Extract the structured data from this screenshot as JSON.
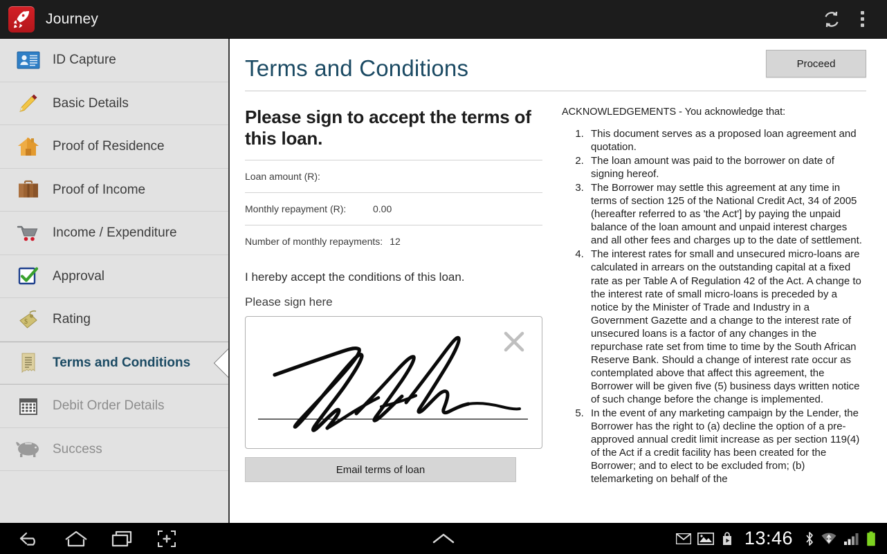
{
  "actionbar": {
    "app_name": "Journey",
    "logo_icon": "rocket-icon",
    "refresh_icon": "refresh-icon",
    "overflow_icon": "overflow-menu-icon"
  },
  "sidebar": {
    "items": [
      {
        "label": "ID Capture",
        "icon": "id-card-icon",
        "state": "normal"
      },
      {
        "label": "Basic Details",
        "icon": "pencil-icon",
        "state": "normal"
      },
      {
        "label": "Proof of Residence",
        "icon": "house-icon",
        "state": "normal"
      },
      {
        "label": "Proof of Income",
        "icon": "briefcase-icon",
        "state": "normal"
      },
      {
        "label": "Income / Expenditure",
        "icon": "cart-icon",
        "state": "normal"
      },
      {
        "label": "Approval",
        "icon": "checkbox-icon",
        "state": "normal"
      },
      {
        "label": "Rating",
        "icon": "tag-icon",
        "state": "normal"
      },
      {
        "label": "Terms and Conditions",
        "icon": "receipt-icon",
        "state": "active"
      },
      {
        "label": "Debit Order Details",
        "icon": "calendar-icon",
        "state": "muted"
      },
      {
        "label": "Success",
        "icon": "piggy-bank-icon",
        "state": "muted"
      }
    ]
  },
  "main": {
    "page_title": "Terms and Conditions",
    "proceed_label": "Proceed",
    "sign_heading": "Please sign to accept the terms of this loan.",
    "fields": [
      {
        "key": "Loan amount (R):",
        "value": ""
      },
      {
        "key": "Monthly repayment (R):",
        "value": "0.00"
      },
      {
        "key": "Number of monthly repayments:",
        "value": "12"
      }
    ],
    "accept_line": "I hereby accept the conditions of this loan.",
    "sign_prompt": "Please sign here",
    "clear_signature_icon": "clear-x-icon",
    "email_label": "Email terms of loan",
    "ack_title": "ACKNOWLEDGEMENTS - You acknowledge that:",
    "ack_items": [
      "This document serves as a proposed loan agreement and quotation.",
      "The loan amount was paid to the borrower on date of signing hereof.",
      "The Borrower may settle this agreement at any time in terms of section 125 of the National Credit Act, 34 of 2005 (hereafter referred to as 'the Act'] by paying the unpaid balance of the loan amount and unpaid interest charges and all other fees and charges up to the date of settlement.",
      "The interest rates for small and unsecured micro-loans are calculated in arrears on the outstanding capital at a fixed rate as per Table A of Regulation 42 of the Act. A change to the interest rate of small micro-loans is preceded by a notice by the Minister of Trade and Industry in a Government Gazette and a change to the interest rate of unsecured loans is a factor of any changes in the repurchase rate set from time to time by the South African Reserve Bank. Should a change of interest rate occur as contemplated above that affect this agreement, the Borrower will be given five (5) business days written notice of such change before the change is implemented.",
      "In the event of any marketing campaign by the Lender, the Borrower has the right to (a) decline the option of a pre-approved annual credit limit increase as per section 119(4) of the Act if a credit facility has been created for the Borrower; and to elect to be excluded from; (b) telemarketing on behalf of the"
    ]
  },
  "systembar": {
    "back_icon": "back-icon",
    "home_icon": "home-icon",
    "recents_icon": "recent-apps-icon",
    "screenshot_icon": "screenshot-icon",
    "expand_icon": "expand-chevron-icon",
    "mail_icon": "mail-icon",
    "gallery_icon": "gallery-icon",
    "playstore_icon": "play-store-icon",
    "clock": "13:46",
    "bluetooth_icon": "bluetooth-icon",
    "wifi_icon": "wifi-icon",
    "signal_icon": "cell-signal-icon",
    "battery_icon": "battery-icon"
  },
  "colors": {
    "accent_title": "#1b4a63",
    "actionbar_bg": "#1c1c1c",
    "sidebar_bg": "#e2e2e2",
    "logo_red": "#d42026",
    "battery_green": "#7ed321"
  }
}
